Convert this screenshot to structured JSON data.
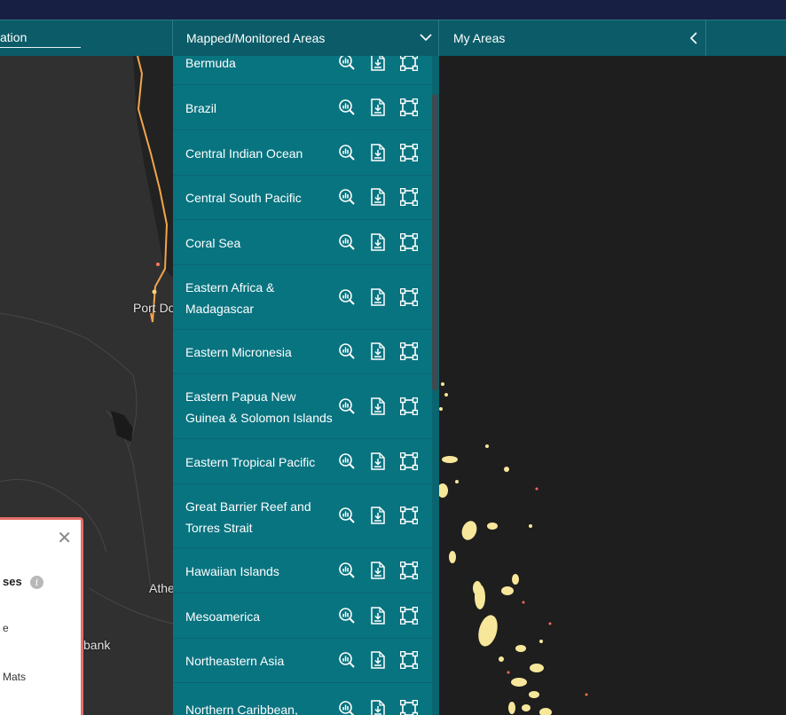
{
  "toolbar": {
    "search_label": "ation",
    "mapped_label": "Mapped/Monitored Areas",
    "myareas_label": "My Areas"
  },
  "map": {
    "labels": [
      "Port Do",
      "Athe",
      "bank"
    ]
  },
  "legend": {
    "close": "✕",
    "header": "ses",
    "info": "i",
    "items": [
      "e",
      "Mats"
    ]
  },
  "areas": [
    {
      "name": "Bermuda"
    },
    {
      "name": "Brazil"
    },
    {
      "name": "Central Indian Ocean"
    },
    {
      "name": "Central South Pacific"
    },
    {
      "name": "Coral Sea"
    },
    {
      "name": "Eastern Africa & Madagascar"
    },
    {
      "name": "Eastern Micronesia"
    },
    {
      "name": "Eastern Papua New Guinea & Solomon Islands"
    },
    {
      "name": "Eastern Tropical Pacific"
    },
    {
      "name": "Great Barrier Reef and Torres Strait"
    },
    {
      "name": "Hawaiian Islands"
    },
    {
      "name": "Mesoamerica"
    },
    {
      "name": "Northeastern Asia"
    },
    {
      "name": "Northern Caribbean,"
    }
  ],
  "icons": {
    "row_actions": [
      "zoom-stats-icon",
      "download-file-icon",
      "bounding-box-icon"
    ],
    "mapped_chevron": "chevron-down-icon",
    "myareas_chevron": "chevron-left-icon",
    "legend_close": "close-icon",
    "legend_info": "info-icon"
  },
  "colors": {
    "nav": "#172042",
    "toolbar": "#0b5c68",
    "list": "#087480",
    "map_land": "#303030",
    "map_dark": "#1e1e1e",
    "reef": "#f7e79a",
    "legend_border": "#e36f6a"
  }
}
